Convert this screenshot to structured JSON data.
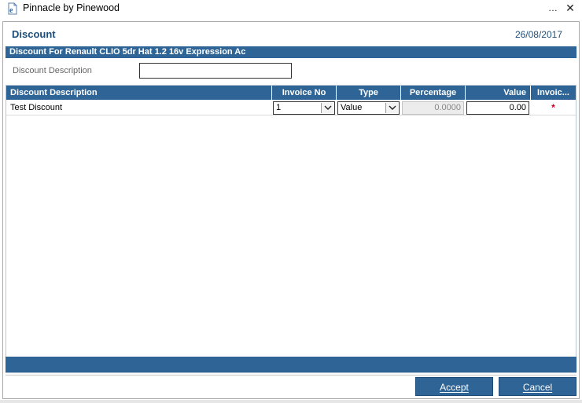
{
  "window": {
    "title": "Pinnacle by Pinewood",
    "app_icon": "ie-document-icon",
    "more_glyph": "…",
    "close_glyph": "✕"
  },
  "header": {
    "title": "Discount",
    "date": "26/08/2017"
  },
  "section": {
    "title": "Discount For Renault CLIO 5dr Hat 1.2 16v Expression Ac"
  },
  "form": {
    "description_label": "Discount Description",
    "description_value": ""
  },
  "grid": {
    "columns": {
      "description": "Discount Description",
      "invoice_no": "Invoice No",
      "type": "Type",
      "percentage": "Percentage",
      "value": "Value",
      "invoice": "Invoic..."
    },
    "rows": [
      {
        "description": "Test Discount",
        "invoice_no": "1",
        "type": "Value",
        "percentage": "0.0000",
        "value": "0.00",
        "invoice_marker": "*"
      }
    ]
  },
  "buttons": {
    "accept": "Accept",
    "cancel": "Cancel"
  },
  "colors": {
    "accent": "#2e6496",
    "title_text": "#1f4e79",
    "required": "#d0001b"
  }
}
